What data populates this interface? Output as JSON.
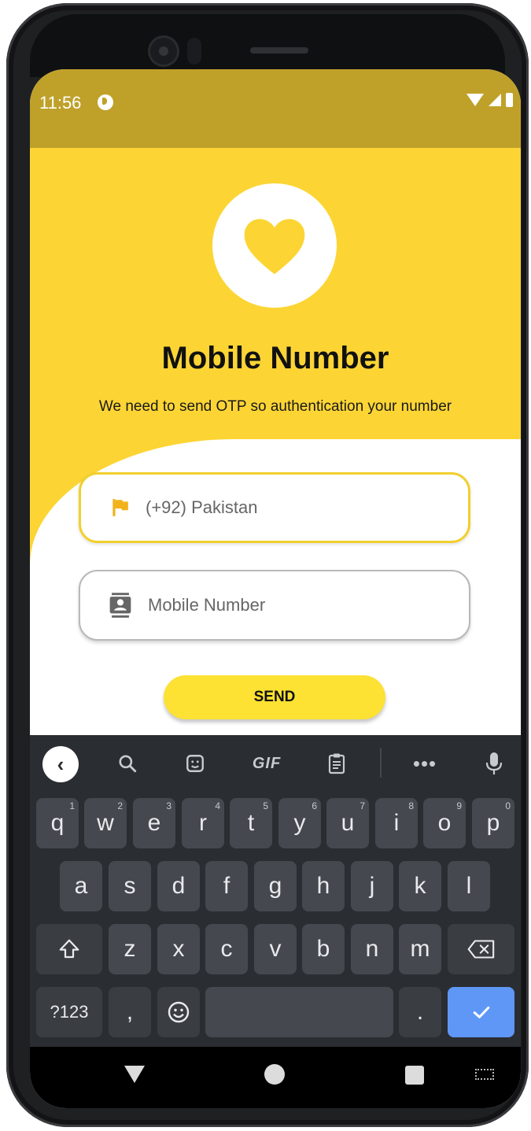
{
  "status_bar": {
    "time": "11:56"
  },
  "header": {
    "title": "Mobile Number",
    "subtitle": "We need to send OTP so authentication your number"
  },
  "form": {
    "country_placeholder": "(+92) Pakistan",
    "mobile_placeholder": "Mobile Number",
    "send_label": "SEND"
  },
  "keyboard": {
    "toolbar": {
      "gif_label": "GIF"
    },
    "row1": [
      {
        "key": "q",
        "hint": "1"
      },
      {
        "key": "w",
        "hint": "2"
      },
      {
        "key": "e",
        "hint": "3"
      },
      {
        "key": "r",
        "hint": "4"
      },
      {
        "key": "t",
        "hint": "5"
      },
      {
        "key": "y",
        "hint": "6"
      },
      {
        "key": "u",
        "hint": "7"
      },
      {
        "key": "i",
        "hint": "8"
      },
      {
        "key": "o",
        "hint": "9"
      },
      {
        "key": "p",
        "hint": "0"
      }
    ],
    "row2": [
      "a",
      "s",
      "d",
      "f",
      "g",
      "h",
      "j",
      "k",
      "l"
    ],
    "row3": [
      "z",
      "x",
      "c",
      "v",
      "b",
      "n",
      "m"
    ],
    "symbols_label": "?123",
    "comma_label": ",",
    "period_label": "."
  },
  "colors": {
    "accent_yellow": "#fcd535",
    "status_bar": "#bfa12a",
    "button": "#fde133",
    "keyboard_bg": "#2a2d31",
    "enter_key": "#5e97f6"
  }
}
